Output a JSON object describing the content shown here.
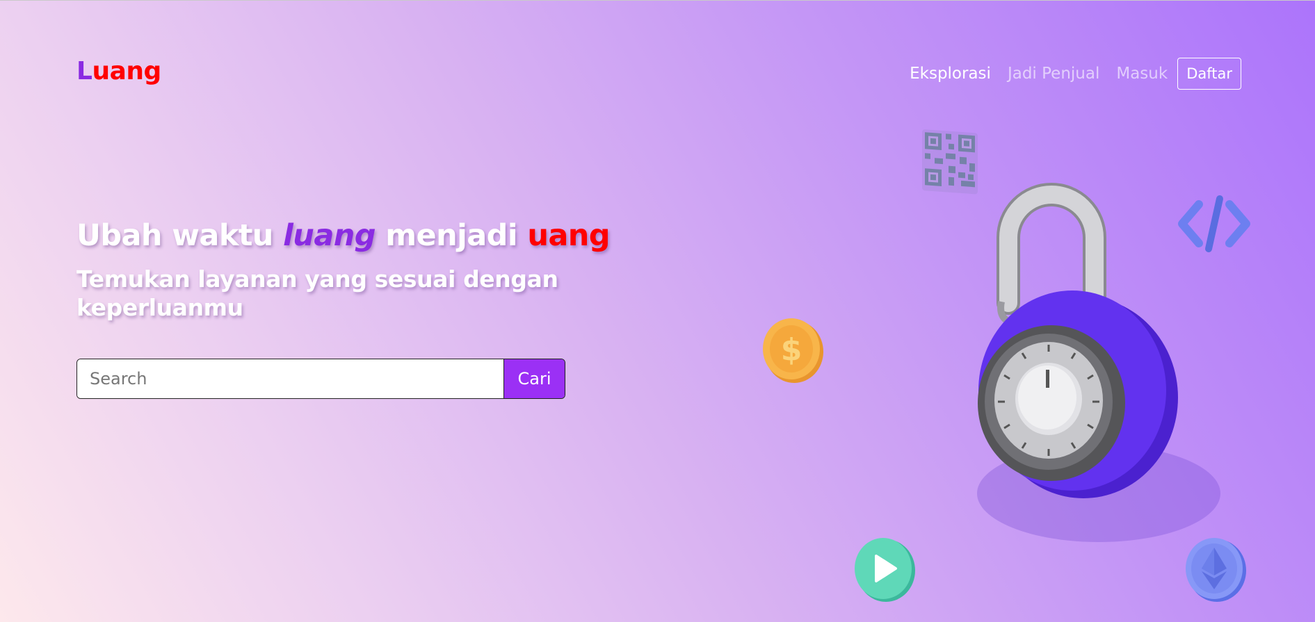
{
  "header": {
    "logo_first": "L",
    "logo_rest": "uang",
    "nav": [
      {
        "label": "Eksplorasi"
      },
      {
        "label": "Jadi Penjual"
      },
      {
        "label": "Masuk"
      },
      {
        "label": "Daftar"
      }
    ]
  },
  "hero": {
    "headline_part1": "Ubah waktu ",
    "headline_luang": "luang",
    "headline_part2": " menjadi ",
    "headline_uang": "uang",
    "subheadline": "Temukan layanan yang sesuai dengan keperluanmu"
  },
  "search": {
    "placeholder": "Search",
    "button_label": "Cari"
  },
  "colors": {
    "accent_purple": "#8a2be2",
    "accent_red": "#ff0000",
    "button_purple": "#9b30f5"
  },
  "illustration": {
    "icons": [
      "qr-code-icon",
      "padlock-icon",
      "code-brackets-icon",
      "dollar-coin-icon",
      "play-button-icon",
      "ethereum-coin-icon"
    ]
  }
}
